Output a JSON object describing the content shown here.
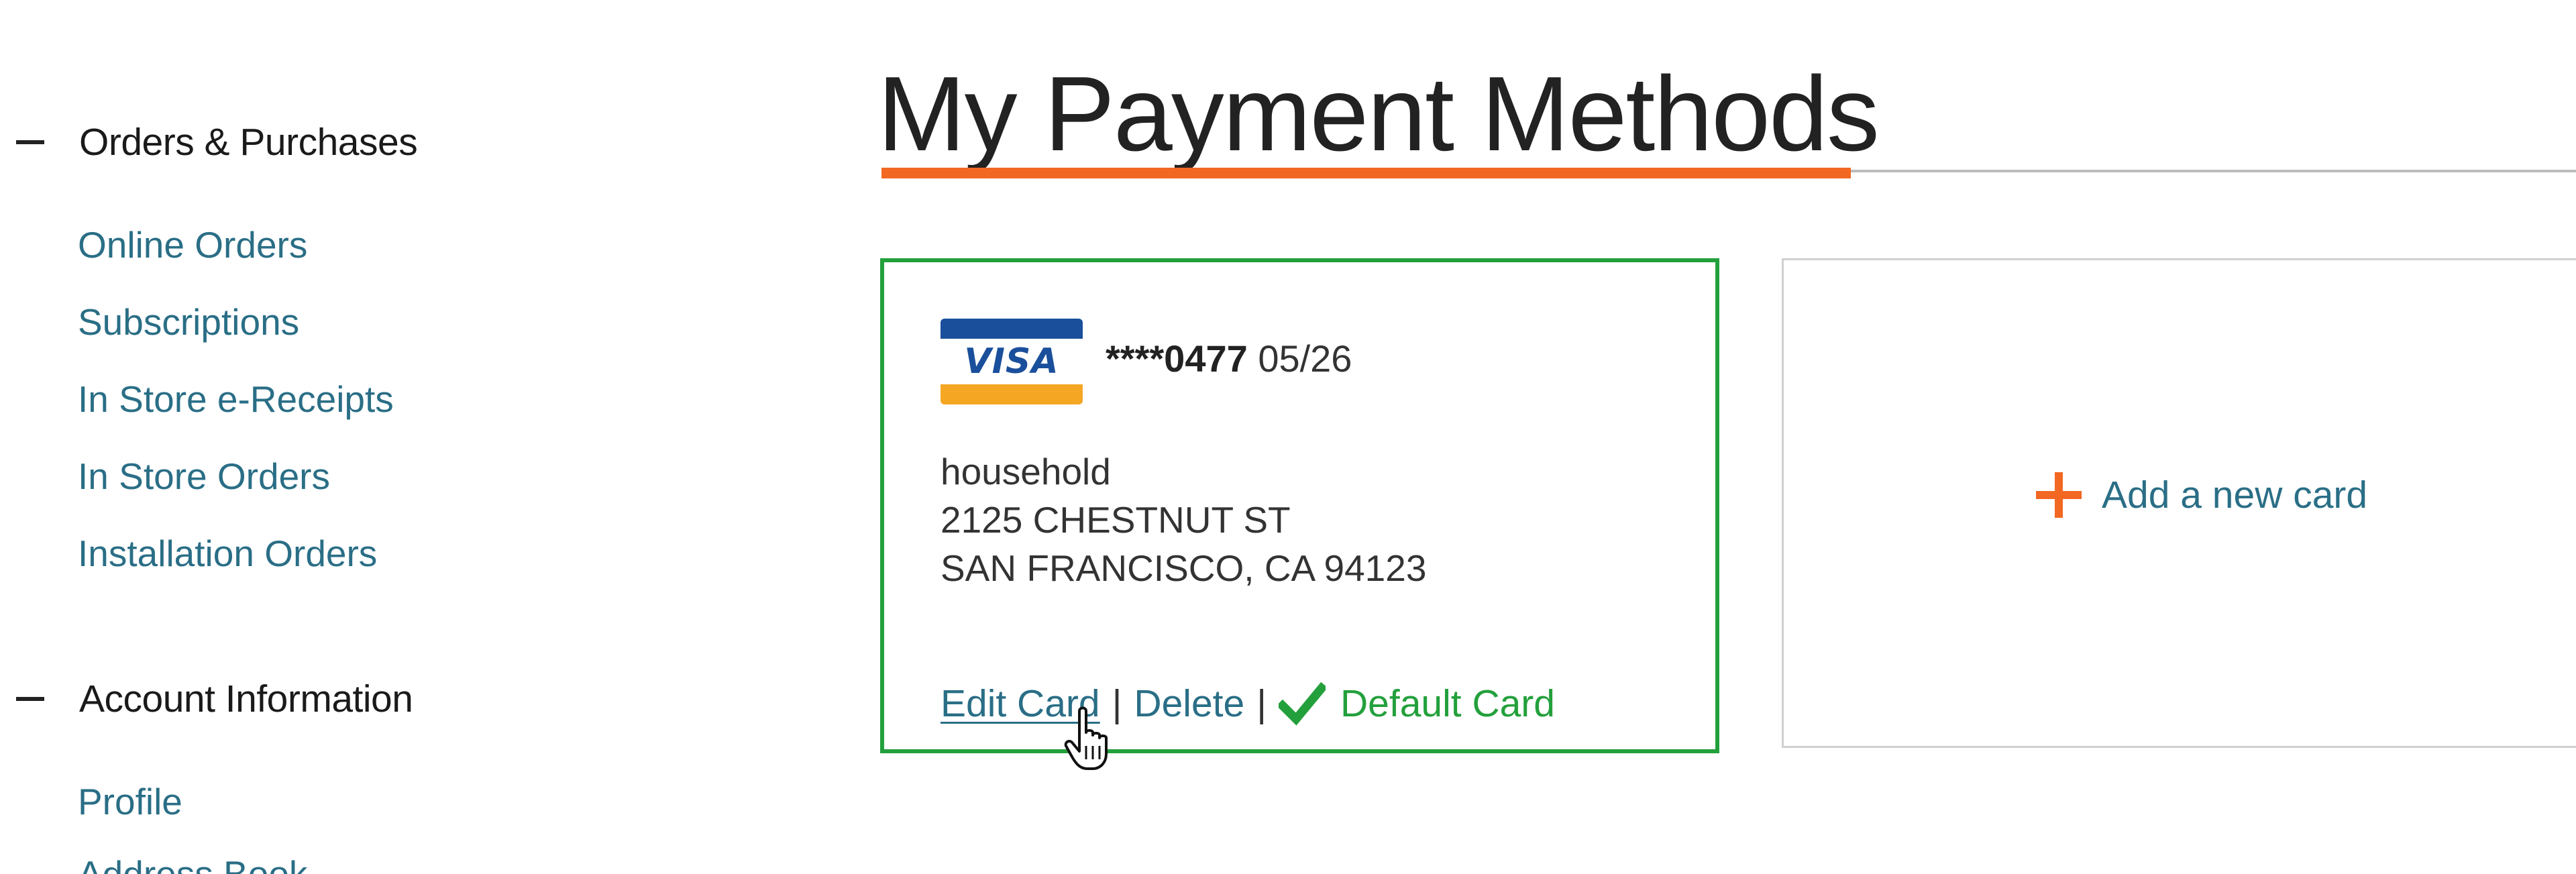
{
  "sidebar": {
    "sections": [
      {
        "title": "Orders & Purchases",
        "items": [
          "Online Orders",
          "Subscriptions",
          "In Store e-Receipts",
          "In Store Orders",
          "Installation Orders"
        ]
      },
      {
        "title": "Account Information",
        "items": [
          "Profile",
          "Address Book"
        ]
      }
    ]
  },
  "main": {
    "title": "My Payment Methods",
    "card": {
      "brand": "VISA",
      "masked_number": "****0477",
      "expiry": "05/26",
      "nickname": "household",
      "address_line1": "2125 CHESTNUT ST",
      "address_line2": "SAN FRANCISCO, CA 94123",
      "edit_label": "Edit Card",
      "separator": "|",
      "delete_label": "Delete",
      "default_label": "Default Card"
    },
    "add_card_label": "Add a new card"
  },
  "icons": {
    "section_toggle": "minus-icon",
    "default_marker": "checkmark-icon",
    "add": "plus-icon",
    "cursor": "hand-pointer-icon"
  },
  "colors": {
    "link": "#2a6e86",
    "accent_orange": "#f26722",
    "default_green": "#23a03c",
    "text_dark": "#222222"
  }
}
